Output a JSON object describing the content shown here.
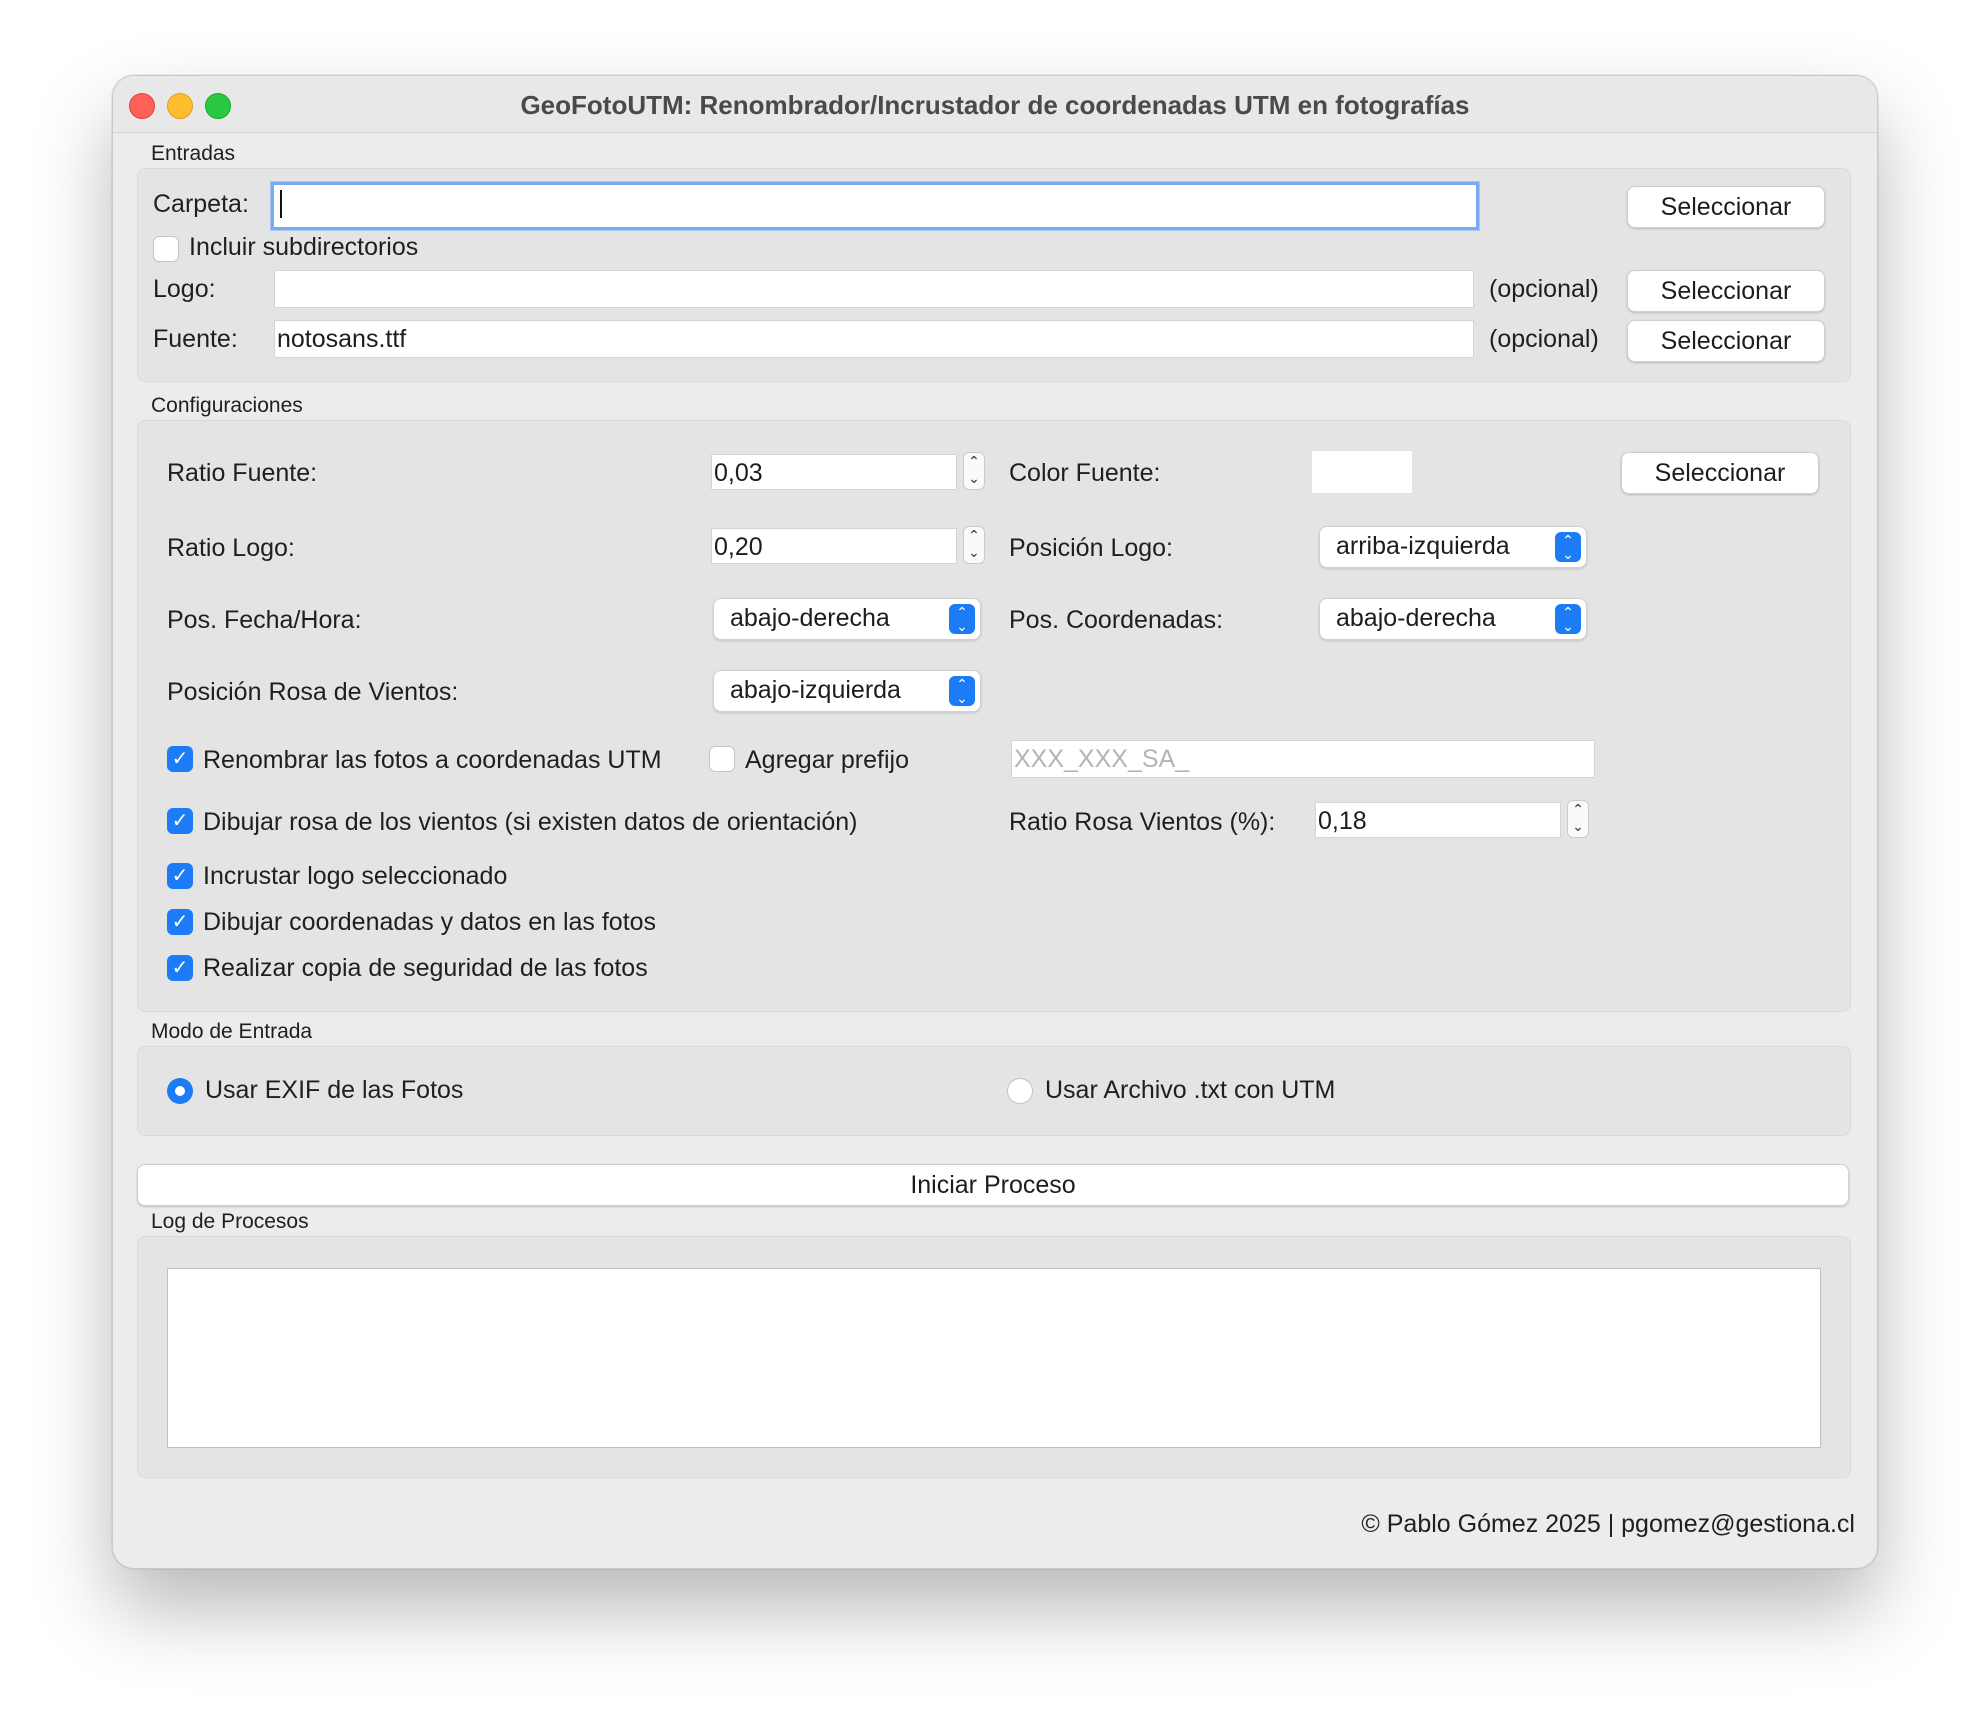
{
  "window": {
    "title": "GeoFotoUTM: Renombrador/Incrustador de coordenadas UTM en fotografías"
  },
  "entradas": {
    "group_label": "Entradas",
    "carpeta_label": "Carpeta:",
    "carpeta_value": "",
    "incluir_sub_label": "Incluir subdirectorios",
    "incluir_sub_checked": false,
    "logo_label": "Logo:",
    "logo_value": "",
    "fuente_label": "Fuente:",
    "fuente_value": "notosans.ttf",
    "opcional": "(opcional)",
    "seleccionar": "Seleccionar"
  },
  "config": {
    "group_label": "Configuraciones",
    "ratio_fuente_label": "Ratio Fuente:",
    "ratio_fuente_value": "0,03",
    "color_fuente_label": "Color Fuente:",
    "color_fuente_value": "#ffffff",
    "seleccionar": "Seleccionar",
    "ratio_logo_label": "Ratio Logo:",
    "ratio_logo_value": "0,20",
    "posicion_logo_label": "Posición Logo:",
    "posicion_logo_value": "arriba-izquierda",
    "pos_fecha_label": "Pos. Fecha/Hora:",
    "pos_fecha_value": "abajo-derecha",
    "pos_coord_label": "Pos. Coordenadas:",
    "pos_coord_value": "abajo-derecha",
    "pos_rosa_label": "Posición Rosa de Vientos:",
    "pos_rosa_value": "abajo-izquierda",
    "renombrar_label": "Renombrar las fotos a coordenadas UTM",
    "agregar_prefijo_label": "Agregar prefijo",
    "prefijo_placeholder": "XXX_XXX_SA_",
    "dibujar_rosa_label": "Dibujar rosa de los vientos (si existen datos de orientación)",
    "ratio_rosa_label": "Ratio Rosa Vientos (%):",
    "ratio_rosa_value": "0,18",
    "incrustar_logo_label": "Incrustar logo seleccionado",
    "dibujar_coord_label": "Dibujar coordenadas y datos en las fotos",
    "copia_seguridad_label": "Realizar copia de seguridad de las fotos"
  },
  "modo": {
    "group_label": "Modo de Entrada",
    "exif_label": "Usar EXIF de las Fotos",
    "txt_label": "Usar Archivo .txt con UTM",
    "selected": "exif"
  },
  "proceso": {
    "iniciar_label": "Iniciar Proceso"
  },
  "log": {
    "group_label": "Log de Procesos",
    "content": ""
  },
  "footer": {
    "copyright": "© Pablo Gómez 2025 | pgomez@gestiona.cl"
  },
  "colors": {
    "accent": "#1b7cf5",
    "focus_ring": "#7aaaf0"
  }
}
